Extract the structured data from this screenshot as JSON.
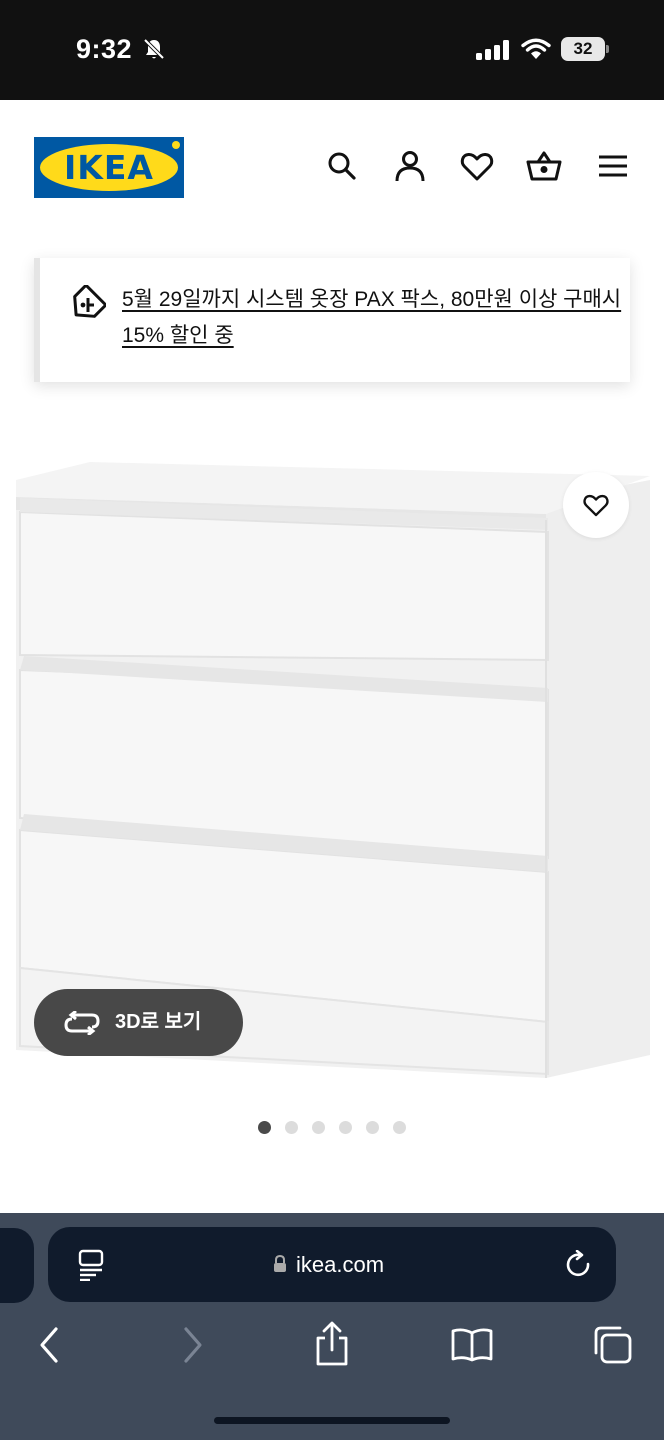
{
  "status_bar": {
    "time": "9:32",
    "battery_level": "32",
    "icons": [
      "bell-slash-icon",
      "cellular-signal-icon",
      "wifi-icon",
      "battery-icon"
    ]
  },
  "header": {
    "logo_text": "IKEA",
    "icons": [
      "search-icon",
      "account-icon",
      "favorites-heart-icon",
      "shopping-basket-icon",
      "hamburger-menu-icon"
    ]
  },
  "promo": {
    "text": "5월 29일까지 시스템 옷장 PAX 팍스, 80만원 이상 구매시 15% 할인 중",
    "icon": "price-tag-icon"
  },
  "product_gallery": {
    "view_3d_label": "3D로 보기",
    "total_images": 6,
    "active_index": 0,
    "favorite_icon": "heart-outline-icon"
  },
  "browser": {
    "url": "ikea.com",
    "icons": [
      "reader-mode-icon",
      "lock-icon",
      "reload-icon",
      "back-icon",
      "forward-icon",
      "share-icon",
      "bookmarks-icon",
      "tabs-icon"
    ]
  },
  "colors": {
    "ikea_blue": "#0058a3",
    "ikea_yellow": "#ffda1a",
    "browser_bar": "#3f4a5a",
    "address_bar": "#101b2c"
  }
}
